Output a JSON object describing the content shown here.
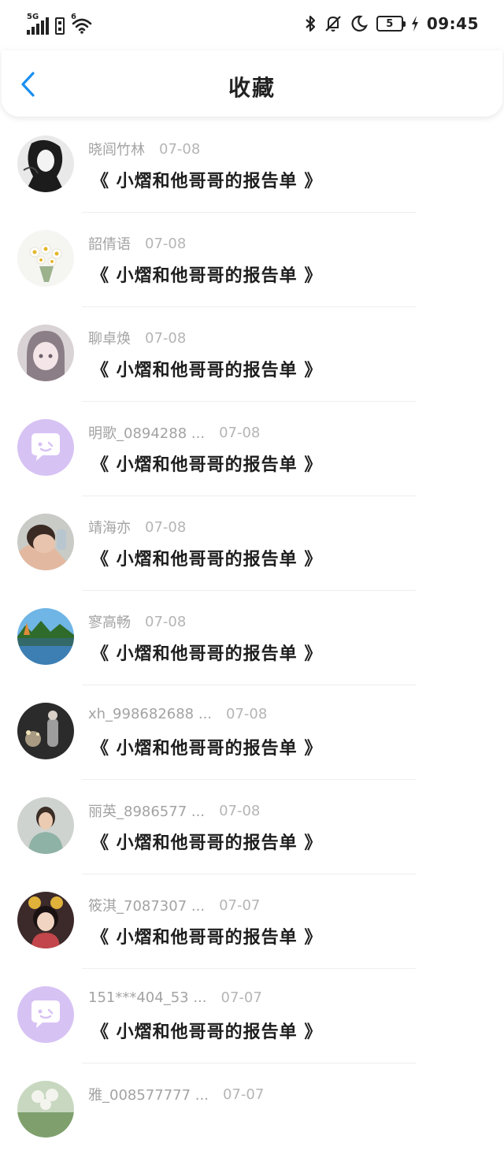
{
  "status_bar": {
    "network_label": "5G",
    "wifi_label": "6",
    "battery_level": "5",
    "time": "09:45"
  },
  "nav": {
    "title": "收藏"
  },
  "items": [
    {
      "name": "晓闾竹林",
      "date": "07-08",
      "title": "《 小熠和他哥哥的报告单 》",
      "avatar": "photo-ink-girl"
    },
    {
      "name": "韶倩语",
      "date": "07-08",
      "title": "《 小熠和他哥哥的报告单 》",
      "avatar": "photo-daisies"
    },
    {
      "name": "聊卓焕",
      "date": "07-08",
      "title": "《 小熠和他哥哥的报告单 》",
      "avatar": "photo-anime-girl"
    },
    {
      "name": "明歌_0894288 ...",
      "date": "07-08",
      "title": "《 小熠和他哥哥的报告单 》",
      "avatar": "default-chat-bubble"
    },
    {
      "name": "靖海亦",
      "date": "07-08",
      "title": "《 小熠和他哥哥的报告单 》",
      "avatar": "photo-child"
    },
    {
      "name": "寥高畅",
      "date": "07-08",
      "title": "《 小熠和他哥哥的报告单 》",
      "avatar": "photo-lake"
    },
    {
      "name": "xh_998682688 ...",
      "date": "07-08",
      "title": "《 小熠和他哥哥的报告单 》",
      "avatar": "photo-fireworks"
    },
    {
      "name": "丽英_8986577 ...",
      "date": "07-08",
      "title": "《 小熠和他哥哥的报告单 》",
      "avatar": "photo-woman"
    },
    {
      "name": "筱淇_7087307 ...",
      "date": "07-07",
      "title": "《 小熠和他哥哥的报告单 》",
      "avatar": "photo-mickey-girl"
    },
    {
      "name": "151***404_53 ...",
      "date": "07-07",
      "title": "《 小熠和他哥哥的报告单 》",
      "avatar": "default-chat-bubble"
    },
    {
      "name": "雅_008577777 ...",
      "date": "07-07",
      "title": "",
      "avatar": "photo-flowers"
    }
  ],
  "colors": {
    "accent": "#1a8ff0",
    "default_avatar": "#d7c2f4"
  }
}
